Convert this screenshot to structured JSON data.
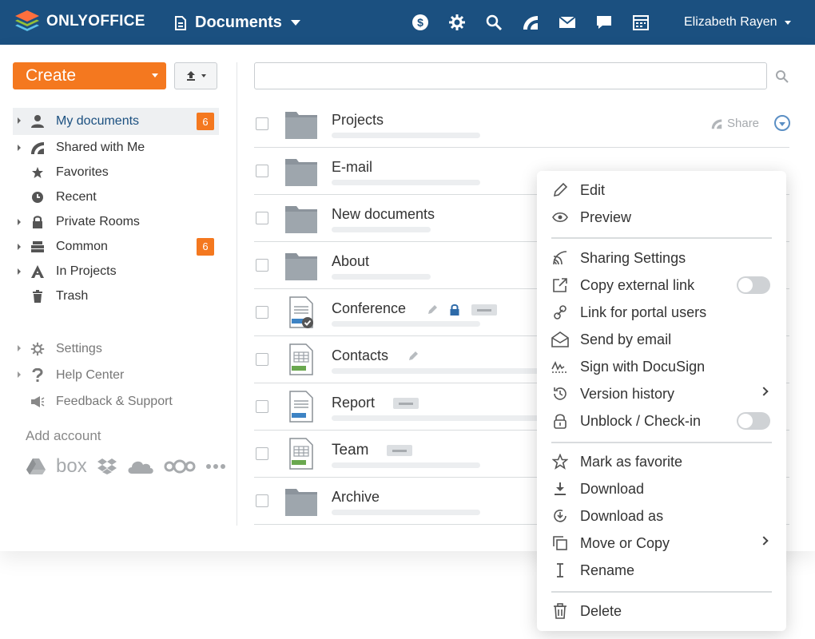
{
  "header": {
    "brand": "ONLYOFFICE",
    "module_title": "Documents",
    "user_name": "Elizabeth Rayen",
    "icons": [
      "billing-icon",
      "settings-icon",
      "search-icon",
      "feed-icon",
      "mail-icon",
      "chat-icon",
      "calendar-icon"
    ]
  },
  "toolbar": {
    "create_label": "Create"
  },
  "sidebar": {
    "items": [
      {
        "label": "My documents",
        "badge": "6"
      },
      {
        "label": "Shared with Me"
      },
      {
        "label": "Favorites"
      },
      {
        "label": "Recent"
      },
      {
        "label": "Private Rooms"
      },
      {
        "label": "Common",
        "badge": "6"
      },
      {
        "label": "In Projects"
      },
      {
        "label": "Trash"
      }
    ],
    "secondary": [
      {
        "label": "Settings"
      },
      {
        "label": "Help Center"
      },
      {
        "label": "Feedback & Support"
      }
    ],
    "add_account": "Add account",
    "cloud_services": {
      "box": "box"
    }
  },
  "search": {
    "placeholder": ""
  },
  "files": [
    {
      "name": "Projects",
      "type": "folder"
    },
    {
      "name": "E-mail",
      "type": "folder"
    },
    {
      "name": "New documents",
      "type": "folder"
    },
    {
      "name": "About",
      "type": "folder"
    },
    {
      "name": "Conference",
      "type": "docx"
    },
    {
      "name": "Contacts",
      "type": "xlsx"
    },
    {
      "name": "Report",
      "type": "docx"
    },
    {
      "name": "Team",
      "type": "xlsx"
    },
    {
      "name": "Archive",
      "type": "folder"
    }
  ],
  "row_actions": {
    "share_label": "Share"
  },
  "context_menu": {
    "items": [
      {
        "label": "Edit"
      },
      {
        "label": "Preview"
      },
      {
        "label": "Sharing Settings"
      },
      {
        "label": "Copy external link"
      },
      {
        "label": "Link for portal users"
      },
      {
        "label": "Send by email"
      },
      {
        "label": "Sign with DocuSign"
      },
      {
        "label": "Version history"
      },
      {
        "label": "Unblock / Check-in"
      },
      {
        "label": "Mark as favorite"
      },
      {
        "label": "Download"
      },
      {
        "label": "Download as"
      },
      {
        "label": "Move or Copy"
      },
      {
        "label": "Rename"
      },
      {
        "label": "Delete"
      }
    ]
  },
  "colors": {
    "header_bg": "#1b5080",
    "accent": "#f4781f",
    "link_blue": "#1b5080"
  }
}
